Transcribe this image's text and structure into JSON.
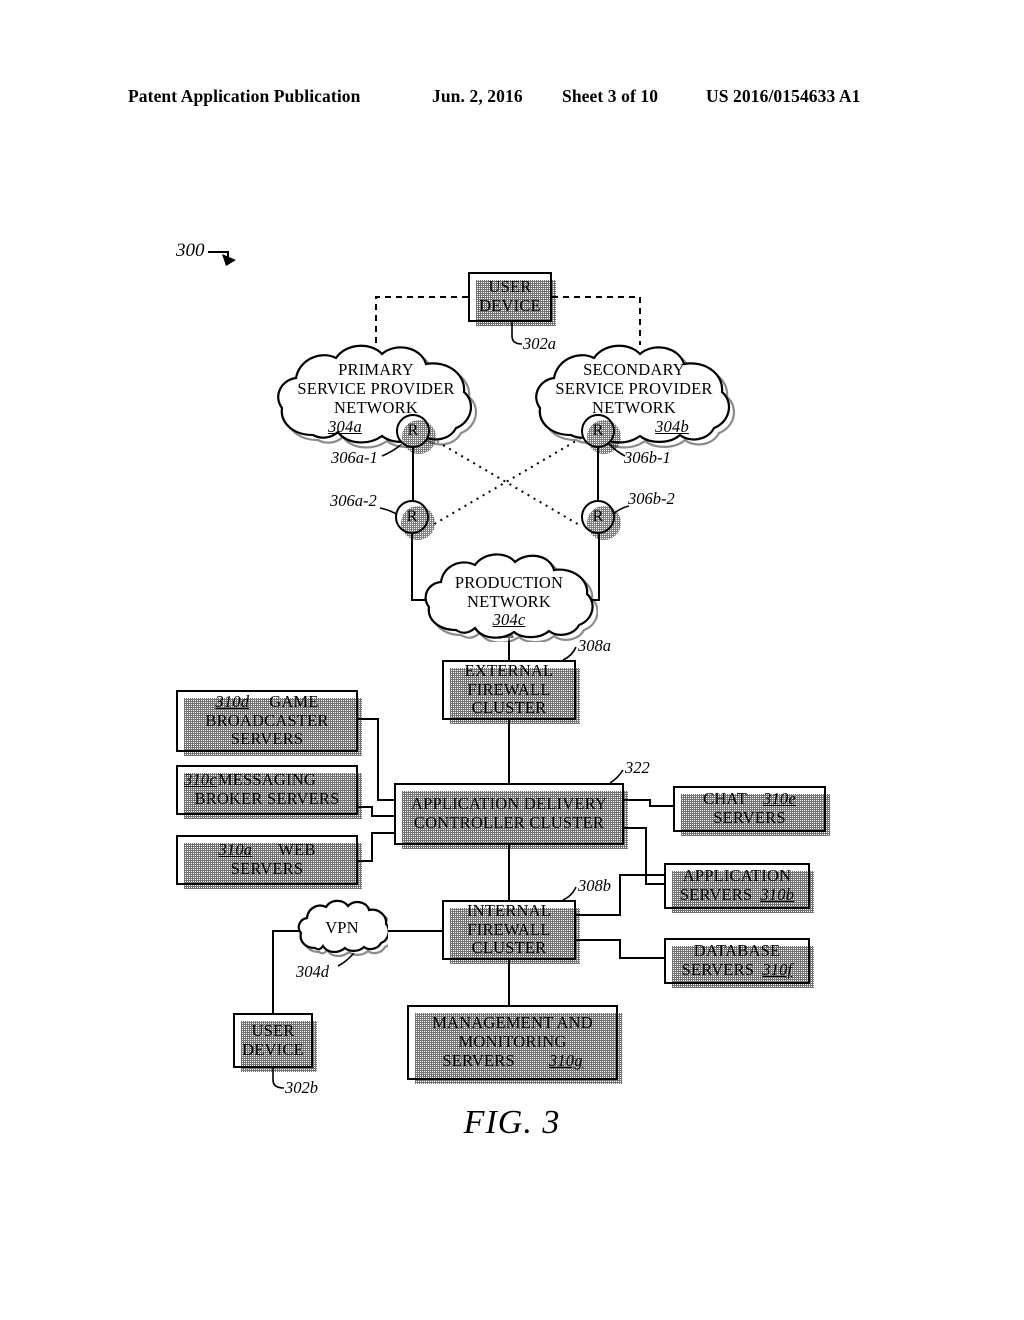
{
  "header": {
    "left": "Patent Application Publication",
    "date": "Jun. 2, 2016",
    "sheet": "Sheet 3 of 10",
    "publication": "US 2016/0154633 A1"
  },
  "figure": {
    "label": "300",
    "caption": "FIG. 3"
  },
  "nodes": {
    "user_device_top": {
      "line1": "USER",
      "line2": "DEVICE",
      "ref": "302a"
    },
    "user_device_bottom": {
      "line1": "USER",
      "line2": "DEVICE",
      "ref": "302b"
    },
    "primary_network": {
      "line1": "PRIMARY",
      "line2": "SERVICE PROVIDER",
      "line3": "NETWORK",
      "ref": "304a"
    },
    "secondary_network": {
      "line1": "SECONDARY",
      "line2": "SERVICE PROVIDER",
      "line3": "NETWORK",
      "ref": "304b"
    },
    "production_network": {
      "line1": "PRODUCTION",
      "line2": "NETWORK",
      "ref": "304c"
    },
    "vpn": {
      "line1": "VPN",
      "ref": "304d"
    },
    "external_firewall": {
      "line1": "EXTERNAL",
      "line2": "FIREWALL",
      "line3": "CLUSTER",
      "ref": "308a"
    },
    "internal_firewall": {
      "line1": "INTERNAL",
      "line2": "FIREWALL",
      "line3": "CLUSTER",
      "ref": "308b"
    },
    "adc_cluster": {
      "line1": "APPLICATION DELIVERY",
      "line2": "CONTROLLER CLUSTER",
      "ref": "322"
    },
    "game_broadcaster_servers": {
      "ref": "310d",
      "line1": "GAME",
      "line2": "BROADCASTER",
      "line3": "SERVERS"
    },
    "messaging_broker_servers": {
      "ref": "310c",
      "line1": "MESSAGING",
      "line2": "BROKER SERVERS"
    },
    "web_servers": {
      "ref": "310a",
      "line1": "WEB",
      "line2": "SERVERS"
    },
    "chat_servers": {
      "ref": "310e",
      "line1": "CHAT",
      "line2": "SERVERS"
    },
    "application_servers": {
      "ref": "310b",
      "line1": "APPLICATION",
      "line2": "SERVERS"
    },
    "database_servers": {
      "ref": "310f",
      "line1": "DATABASE",
      "line2": "SERVERS"
    },
    "management_servers": {
      "ref": "310g",
      "line1": "MANAGEMENT AND",
      "line2": "MONITORING",
      "line3": "SERVERS"
    }
  },
  "routers": {
    "glyph": "R",
    "primary_1": "306a-1",
    "primary_2": "306a-2",
    "secondary_1": "306b-1",
    "secondary_2": "306b-2"
  }
}
